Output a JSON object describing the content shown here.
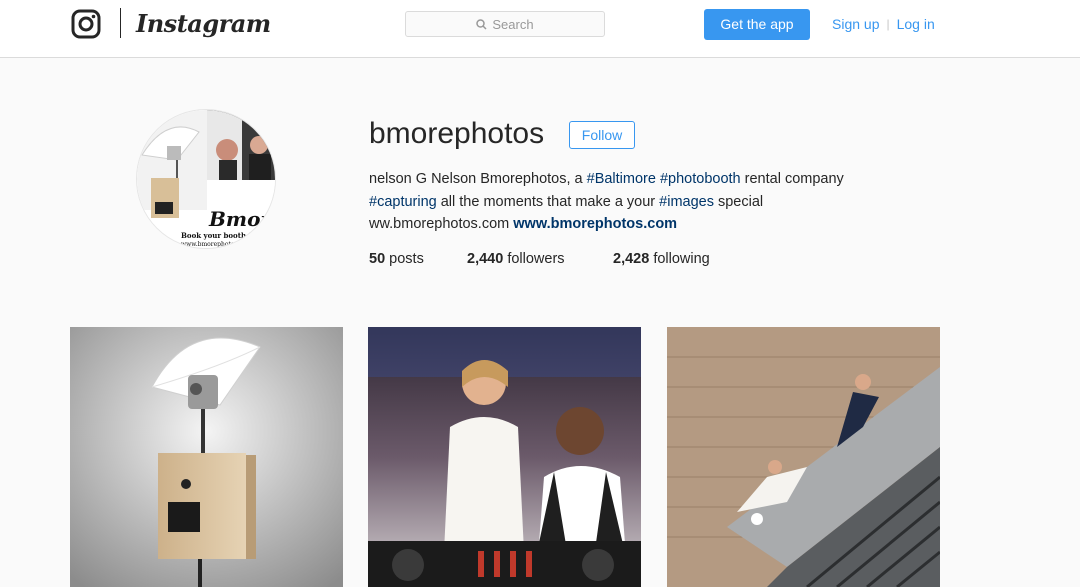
{
  "header": {
    "wordmark": "Instagram",
    "search_placeholder": "Search",
    "get_app_label": "Get the app",
    "signup_label": "Sign up",
    "separator": "|",
    "login_label": "Log in"
  },
  "profile": {
    "username": "bmorephotos",
    "follow_label": "Follow",
    "bio": {
      "line1_text": "nelson G Nelson Bmorephotos, a ",
      "tag_baltimore": "#Baltimore",
      "tag_photobooth": "#photobooth",
      "line1_end": " rental company",
      "tag_capturing": "#capturing",
      "line2_text": " all the moments that make a your ",
      "tag_images": "#images",
      "line2_end": " special",
      "line3_text": "ww.bmorephotos.com ",
      "website": "www.bmorephotos.com"
    },
    "avatar_text": "Bmor",
    "avatar_caption": "Book your booth to",
    "avatar_url_text": "www.bmorephotos",
    "stats": {
      "posts_count": "50",
      "posts_label": "posts",
      "followers_count": "2,440",
      "followers_label": "followers",
      "following_count": "2,428",
      "following_label": "following"
    }
  },
  "colors": {
    "accent": "#3897f0",
    "hashtag": "#003569",
    "text": "#262626",
    "background": "#fafafa"
  },
  "icons": {
    "logo": "instagram-glyph-icon",
    "search": "search-icon"
  }
}
